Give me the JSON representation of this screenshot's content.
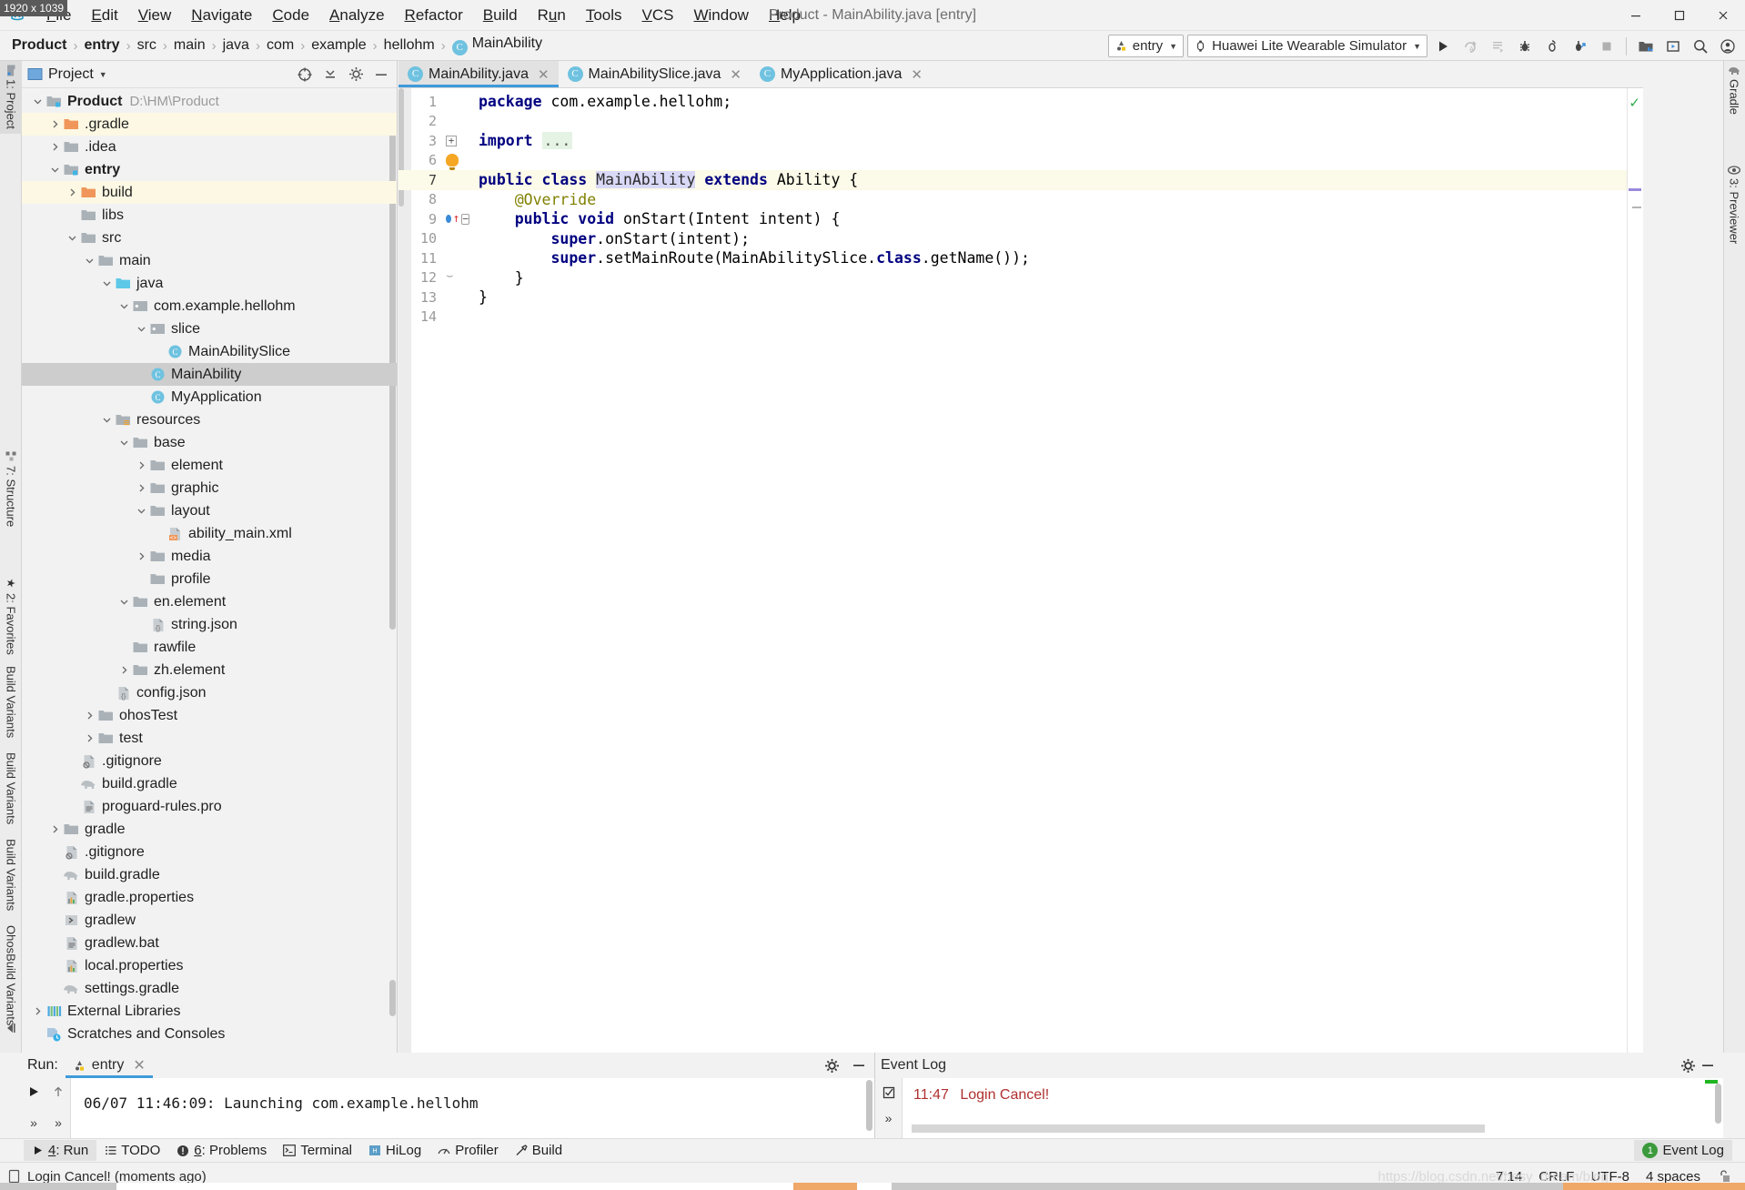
{
  "window": {
    "title": "Product - MainAbility.java [entry]",
    "dimension_badge": "1920 x 1039",
    "controls": {
      "minimize": "─",
      "maximize": "❐",
      "close": "✕"
    }
  },
  "menu": {
    "items": [
      {
        "label": "File",
        "accel": "F"
      },
      {
        "label": "Edit",
        "accel": "E"
      },
      {
        "label": "View",
        "accel": "V"
      },
      {
        "label": "Navigate",
        "accel": "N"
      },
      {
        "label": "Code",
        "accel": "C"
      },
      {
        "label": "Analyze",
        "accel": "A"
      },
      {
        "label": "Refactor",
        "accel": "R"
      },
      {
        "label": "Build",
        "accel": "B"
      },
      {
        "label": "Run",
        "accel": "u"
      },
      {
        "label": "Tools",
        "accel": "T"
      },
      {
        "label": "VCS",
        "accel": "V"
      },
      {
        "label": "Window",
        "accel": "W"
      },
      {
        "label": "Help",
        "accel": "H"
      }
    ]
  },
  "breadcrumb": {
    "separator": "›",
    "items": [
      {
        "label": "Product",
        "bold": true
      },
      {
        "label": "entry",
        "bold": true
      },
      {
        "label": "src",
        "bold": false
      },
      {
        "label": "main",
        "bold": false
      },
      {
        "label": "java",
        "bold": false
      },
      {
        "label": "com",
        "bold": false
      },
      {
        "label": "example",
        "bold": false
      },
      {
        "label": "hellohm",
        "bold": false
      },
      {
        "label": "MainAbility",
        "bold": false,
        "icon": "class-icon",
        "icon_glyph": "C"
      }
    ]
  },
  "toolbar": {
    "run_config": "entry",
    "device": "Huawei Lite Wearable Simulator",
    "buttons": [
      {
        "name": "run-button",
        "title": "Run"
      },
      {
        "name": "rerun-coverage-button",
        "title": "Run with Coverage"
      },
      {
        "name": "run-profiler-button",
        "title": "Profile"
      },
      {
        "name": "debug-button",
        "title": "Debug"
      },
      {
        "name": "attach-debugger-button",
        "title": "Attach Debugger"
      },
      {
        "name": "debug-attach-button",
        "title": "Debug Attach"
      },
      {
        "name": "stop-button",
        "title": "Stop"
      },
      {
        "name": "sdk-manager-button",
        "title": "SDK Manager"
      },
      {
        "name": "device-manager-button",
        "title": "Device Manager"
      },
      {
        "name": "search-everywhere-icon",
        "title": "Search Everywhere"
      },
      {
        "name": "account-icon",
        "title": "Account"
      }
    ]
  },
  "left_strip": {
    "tabs": [
      {
        "label": "1: Project",
        "active": true,
        "icon": "project-icon"
      },
      {
        "label": "7: Structure",
        "active": false,
        "icon": "structure-icon"
      },
      {
        "label": "2: Favorites",
        "active": false,
        "icon": "star-icon"
      },
      {
        "label": "Build Variants",
        "active": false,
        "icon": "variants-icon"
      },
      {
        "label": "Build Variants",
        "active": false,
        "icon": "variants-icon"
      },
      {
        "label": "Build Variants",
        "active": false,
        "icon": "variants-icon"
      },
      {
        "label": "OhosBuild Variants",
        "active": false,
        "icon": "variants-icon"
      }
    ]
  },
  "right_strip": {
    "tabs": [
      {
        "label": "Gradle",
        "icon": "gradle-elephant-icon"
      },
      {
        "label": "3: Previewer",
        "icon": "eye-icon"
      }
    ]
  },
  "project_panel": {
    "title": "Project",
    "header_icons": [
      {
        "name": "select-opened-file-icon"
      },
      {
        "name": "collapse-all-icon"
      },
      {
        "name": "settings-gear-icon"
      },
      {
        "name": "hide-panel-icon"
      }
    ],
    "tree": [
      {
        "depth": 0,
        "arrow": "down",
        "icon": "module-folder-icon",
        "label": "Product",
        "bold": true,
        "path": "D:\\HM\\Product",
        "selected": false,
        "highlight": false
      },
      {
        "depth": 1,
        "arrow": "right",
        "icon": "orange-folder-icon",
        "label": ".gradle",
        "bold": false,
        "selected": false,
        "highlight": true
      },
      {
        "depth": 1,
        "arrow": "right",
        "icon": "folder-icon",
        "label": ".idea",
        "bold": false,
        "selected": false,
        "highlight": false
      },
      {
        "depth": 1,
        "arrow": "down",
        "icon": "module-folder-icon",
        "label": "entry",
        "bold": true,
        "selected": false,
        "highlight": false
      },
      {
        "depth": 2,
        "arrow": "right",
        "icon": "orange-folder-icon",
        "label": "build",
        "bold": false,
        "selected": false,
        "highlight": true
      },
      {
        "depth": 2,
        "arrow": "none",
        "icon": "folder-icon",
        "label": "libs",
        "bold": false,
        "selected": false,
        "highlight": false
      },
      {
        "depth": 2,
        "arrow": "down",
        "icon": "folder-icon",
        "label": "src",
        "bold": false,
        "selected": false,
        "highlight": false
      },
      {
        "depth": 3,
        "arrow": "down",
        "icon": "folder-icon",
        "label": "main",
        "bold": false,
        "selected": false,
        "highlight": false
      },
      {
        "depth": 4,
        "arrow": "down",
        "icon": "source-folder-icon",
        "label": "java",
        "bold": false,
        "selected": false,
        "highlight": false
      },
      {
        "depth": 5,
        "arrow": "down",
        "icon": "package-icon",
        "label": "com.example.hellohm",
        "bold": false,
        "selected": false,
        "highlight": false
      },
      {
        "depth": 6,
        "arrow": "down",
        "icon": "package-icon",
        "label": "slice",
        "bold": false,
        "selected": false,
        "highlight": false
      },
      {
        "depth": 7,
        "arrow": "none",
        "icon": "class-icon",
        "label": "MainAbilitySlice",
        "bold": false,
        "selected": false,
        "highlight": false
      },
      {
        "depth": 6,
        "arrow": "none",
        "icon": "class-icon",
        "label": "MainAbility",
        "bold": false,
        "selected": true,
        "highlight": false
      },
      {
        "depth": 6,
        "arrow": "none",
        "icon": "class-icon",
        "label": "MyApplication",
        "bold": false,
        "selected": false,
        "highlight": false
      },
      {
        "depth": 4,
        "arrow": "down",
        "icon": "resource-folder-icon",
        "label": "resources",
        "bold": false,
        "selected": false,
        "highlight": false
      },
      {
        "depth": 5,
        "arrow": "down",
        "icon": "folder-icon",
        "label": "base",
        "bold": false,
        "selected": false,
        "highlight": false
      },
      {
        "depth": 6,
        "arrow": "right",
        "icon": "folder-icon",
        "label": "element",
        "bold": false,
        "selected": false,
        "highlight": false
      },
      {
        "depth": 6,
        "arrow": "right",
        "icon": "folder-icon",
        "label": "graphic",
        "bold": false,
        "selected": false,
        "highlight": false
      },
      {
        "depth": 6,
        "arrow": "down",
        "icon": "folder-icon",
        "label": "layout",
        "bold": false,
        "selected": false,
        "highlight": false
      },
      {
        "depth": 7,
        "arrow": "none",
        "icon": "xml-file-icon",
        "label": "ability_main.xml",
        "bold": false,
        "selected": false,
        "highlight": false
      },
      {
        "depth": 6,
        "arrow": "right",
        "icon": "folder-icon",
        "label": "media",
        "bold": false,
        "selected": false,
        "highlight": false
      },
      {
        "depth": 6,
        "arrow": "none",
        "icon": "folder-icon",
        "label": "profile",
        "bold": false,
        "selected": false,
        "highlight": false
      },
      {
        "depth": 5,
        "arrow": "down",
        "icon": "folder-icon",
        "label": "en.element",
        "bold": false,
        "selected": false,
        "highlight": false
      },
      {
        "depth": 6,
        "arrow": "none",
        "icon": "json-file-icon",
        "label": "string.json",
        "bold": false,
        "selected": false,
        "highlight": false
      },
      {
        "depth": 5,
        "arrow": "none",
        "icon": "folder-icon",
        "label": "rawfile",
        "bold": false,
        "selected": false,
        "highlight": false
      },
      {
        "depth": 5,
        "arrow": "right",
        "icon": "folder-icon",
        "label": "zh.element",
        "bold": false,
        "selected": false,
        "highlight": false
      },
      {
        "depth": 4,
        "arrow": "none",
        "icon": "json-file-icon",
        "label": "config.json",
        "bold": false,
        "selected": false,
        "highlight": false
      },
      {
        "depth": 3,
        "arrow": "right",
        "icon": "folder-icon",
        "label": "ohosTest",
        "bold": false,
        "selected": false,
        "highlight": false
      },
      {
        "depth": 3,
        "arrow": "right",
        "icon": "folder-icon",
        "label": "test",
        "bold": false,
        "selected": false,
        "highlight": false
      },
      {
        "depth": 2,
        "arrow": "none",
        "icon": "gitignore-file-icon",
        "label": ".gitignore",
        "bold": false,
        "selected": false,
        "highlight": false
      },
      {
        "depth": 2,
        "arrow": "none",
        "icon": "gradle-file-icon",
        "label": "build.gradle",
        "bold": false,
        "selected": false,
        "highlight": false
      },
      {
        "depth": 2,
        "arrow": "none",
        "icon": "text-file-icon",
        "label": "proguard-rules.pro",
        "bold": false,
        "selected": false,
        "highlight": false
      },
      {
        "depth": 1,
        "arrow": "right",
        "icon": "folder-icon",
        "label": "gradle",
        "bold": false,
        "selected": false,
        "highlight": false
      },
      {
        "depth": 1,
        "arrow": "none",
        "icon": "gitignore-file-icon",
        "label": ".gitignore",
        "bold": false,
        "selected": false,
        "highlight": false
      },
      {
        "depth": 1,
        "arrow": "none",
        "icon": "gradle-file-icon",
        "label": "build.gradle",
        "bold": false,
        "selected": false,
        "highlight": false
      },
      {
        "depth": 1,
        "arrow": "none",
        "icon": "properties-file-icon",
        "label": "gradle.properties",
        "bold": false,
        "selected": false,
        "highlight": false
      },
      {
        "depth": 1,
        "arrow": "none",
        "icon": "script-file-icon",
        "label": "gradlew",
        "bold": false,
        "selected": false,
        "highlight": false
      },
      {
        "depth": 1,
        "arrow": "none",
        "icon": "text-file-icon",
        "label": "gradlew.bat",
        "bold": false,
        "selected": false,
        "highlight": false
      },
      {
        "depth": 1,
        "arrow": "none",
        "icon": "properties-file-icon",
        "label": "local.properties",
        "bold": false,
        "selected": false,
        "highlight": false
      },
      {
        "depth": 1,
        "arrow": "none",
        "icon": "gradle-file-icon",
        "label": "settings.gradle",
        "bold": false,
        "selected": false,
        "highlight": false
      },
      {
        "depth": 0,
        "arrow": "right",
        "icon": "libraries-icon",
        "label": "External Libraries",
        "bold": false,
        "selected": false,
        "highlight": false
      },
      {
        "depth": 0,
        "arrow": "none",
        "icon": "scratches-icon",
        "label": "Scratches and Consoles",
        "bold": false,
        "selected": false,
        "highlight": false
      }
    ]
  },
  "editor": {
    "tabs": [
      {
        "label": "MainAbility.java",
        "icon": "class-icon",
        "active": true
      },
      {
        "label": "MainAbilitySlice.java",
        "icon": "class-icon",
        "active": false
      },
      {
        "label": "MyApplication.java",
        "icon": "class-icon",
        "active": false
      }
    ],
    "code_lines": [
      {
        "num": "1",
        "current": false,
        "marks": [],
        "tokens": [
          {
            "t": "package",
            "c": "kw"
          },
          {
            "t": " com.example.hellohm;",
            "c": "plain"
          }
        ]
      },
      {
        "num": "2",
        "current": false,
        "marks": [],
        "tokens": []
      },
      {
        "num": "3",
        "current": false,
        "marks": [
          "fold-plus"
        ],
        "tokens": [
          {
            "t": "import",
            "c": "kw"
          },
          {
            "t": " ",
            "c": "plain"
          },
          {
            "t": "...",
            "c": "fold"
          }
        ]
      },
      {
        "num": "6",
        "current": false,
        "marks": [
          "bulb"
        ],
        "tokens": []
      },
      {
        "num": "7",
        "current": true,
        "marks": [],
        "tokens": [
          {
            "t": "public class ",
            "c": "kw"
          },
          {
            "t": "MainAbility",
            "c": "clshl"
          },
          {
            "t": " ",
            "c": "plain"
          },
          {
            "t": "extends",
            "c": "kw"
          },
          {
            "t": " Ability {",
            "c": "plain"
          }
        ]
      },
      {
        "num": "8",
        "current": false,
        "marks": [],
        "tokens": [
          {
            "t": "    @Override",
            "c": "ann"
          }
        ]
      },
      {
        "num": "9",
        "current": false,
        "marks": [
          "breakpoint",
          "override-arrow",
          "fold-minus"
        ],
        "tokens": [
          {
            "t": "    ",
            "c": "plain"
          },
          {
            "t": "public void",
            "c": "kw"
          },
          {
            "t": " onStart(Intent intent) {",
            "c": "plain"
          }
        ]
      },
      {
        "num": "10",
        "current": false,
        "marks": [],
        "tokens": [
          {
            "t": "        ",
            "c": "plain"
          },
          {
            "t": "super",
            "c": "kw"
          },
          {
            "t": ".onStart(intent);",
            "c": "plain"
          }
        ]
      },
      {
        "num": "11",
        "current": false,
        "marks": [],
        "tokens": [
          {
            "t": "        ",
            "c": "plain"
          },
          {
            "t": "super",
            "c": "kw"
          },
          {
            "t": ".setMainRoute(MainAbilitySlice.",
            "c": "plain"
          },
          {
            "t": "class",
            "c": "kw"
          },
          {
            "t": ".getName());",
            "c": "plain"
          }
        ]
      },
      {
        "num": "12",
        "current": false,
        "marks": [
          "fold-arc"
        ],
        "tokens": [
          {
            "t": "    }",
            "c": "plain"
          }
        ]
      },
      {
        "num": "13",
        "current": false,
        "marks": [],
        "tokens": [
          {
            "t": "}",
            "c": "plain"
          }
        ]
      },
      {
        "num": "14",
        "current": false,
        "marks": [],
        "tokens": []
      }
    ],
    "inspection_status": "✓"
  },
  "run_panel": {
    "label": "Run:",
    "tab": "entry",
    "console_text": "06/07 11:46:09: Launching com.example.hellohm",
    "side_buttons": [
      {
        "name": "rerun-button",
        "glyph": "▶"
      },
      {
        "name": "scroll-up-button",
        "glyph": "↑"
      },
      {
        "name": "expand-left-button",
        "glyph": "»"
      },
      {
        "name": "expand-right-button",
        "glyph": "»"
      }
    ],
    "header_icons": [
      {
        "name": "settings-gear-icon"
      },
      {
        "name": "hide-panel-icon"
      }
    ]
  },
  "event_log": {
    "title": "Event Log",
    "entries": [
      {
        "time": "11:47",
        "message": "Login Cancel!"
      }
    ],
    "header_icons": [
      {
        "name": "settings-gear-icon"
      },
      {
        "name": "hide-panel-icon"
      }
    ]
  },
  "tool_window_bar": {
    "items": [
      {
        "label": "4: Run",
        "accel": "4",
        "icon": "run-icon",
        "active": true
      },
      {
        "label": "TODO",
        "accel": "",
        "icon": "todo-icon",
        "active": false
      },
      {
        "label": "6: Problems",
        "accel": "6",
        "icon": "problems-icon",
        "active": false
      },
      {
        "label": "Terminal",
        "accel": "",
        "icon": "terminal-icon",
        "active": false
      },
      {
        "label": "HiLog",
        "accel": "",
        "icon": "hilog-icon",
        "active": false
      },
      {
        "label": "Profiler",
        "accel": "",
        "icon": "profiler-icon",
        "active": false
      },
      {
        "label": "Build",
        "accel": "",
        "icon": "build-icon",
        "active": false
      }
    ],
    "event_log_label": "Event Log",
    "event_log_count": "1"
  },
  "status_bar": {
    "message": "Login Cancel! (moments ago)",
    "caret_position": "7:14",
    "line_separator": "CRLF",
    "encoding": "UTF-8",
    "indent": "4 spaces",
    "lock_icon": "unlocked-icon",
    "watermark": "https://blog.csdn.net/hesy_dream/blog"
  }
}
